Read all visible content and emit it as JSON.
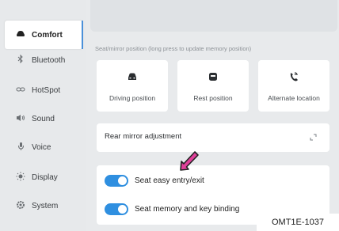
{
  "sidebar": {
    "items": [
      {
        "label": "Comfort",
        "icon": "car-icon",
        "active": true
      },
      {
        "label": "Bluetooth",
        "icon": "bluetooth-icon"
      },
      {
        "label": "HotSpot",
        "icon": "hotspot-icon"
      },
      {
        "label": "Sound",
        "icon": "speaker-icon"
      },
      {
        "label": "Voice",
        "icon": "microphone-icon"
      },
      {
        "label": "Display",
        "icon": "brightness-icon"
      },
      {
        "label": "System",
        "icon": "gear-icon"
      }
    ]
  },
  "main": {
    "hint": "Seat/mirror position (long press to update memory position)",
    "positions": [
      {
        "label": "Driving position",
        "icon": "seat-icon"
      },
      {
        "label": "Rest position",
        "icon": "seat-recline-icon"
      },
      {
        "label": "Alternate location",
        "icon": "steering-icon"
      }
    ],
    "mirror": {
      "label": "Rear mirror adjustment",
      "icon": "expand-icon"
    },
    "toggles": [
      {
        "label": "Seat easy entry/exit",
        "on": true
      },
      {
        "label": "Seat memory and key binding",
        "on": true
      }
    ]
  },
  "figure_code": "OMT1E-1037",
  "colors": {
    "accent": "#2f8fe0",
    "pointer": "#e0409a",
    "background": "#e8eaec"
  }
}
